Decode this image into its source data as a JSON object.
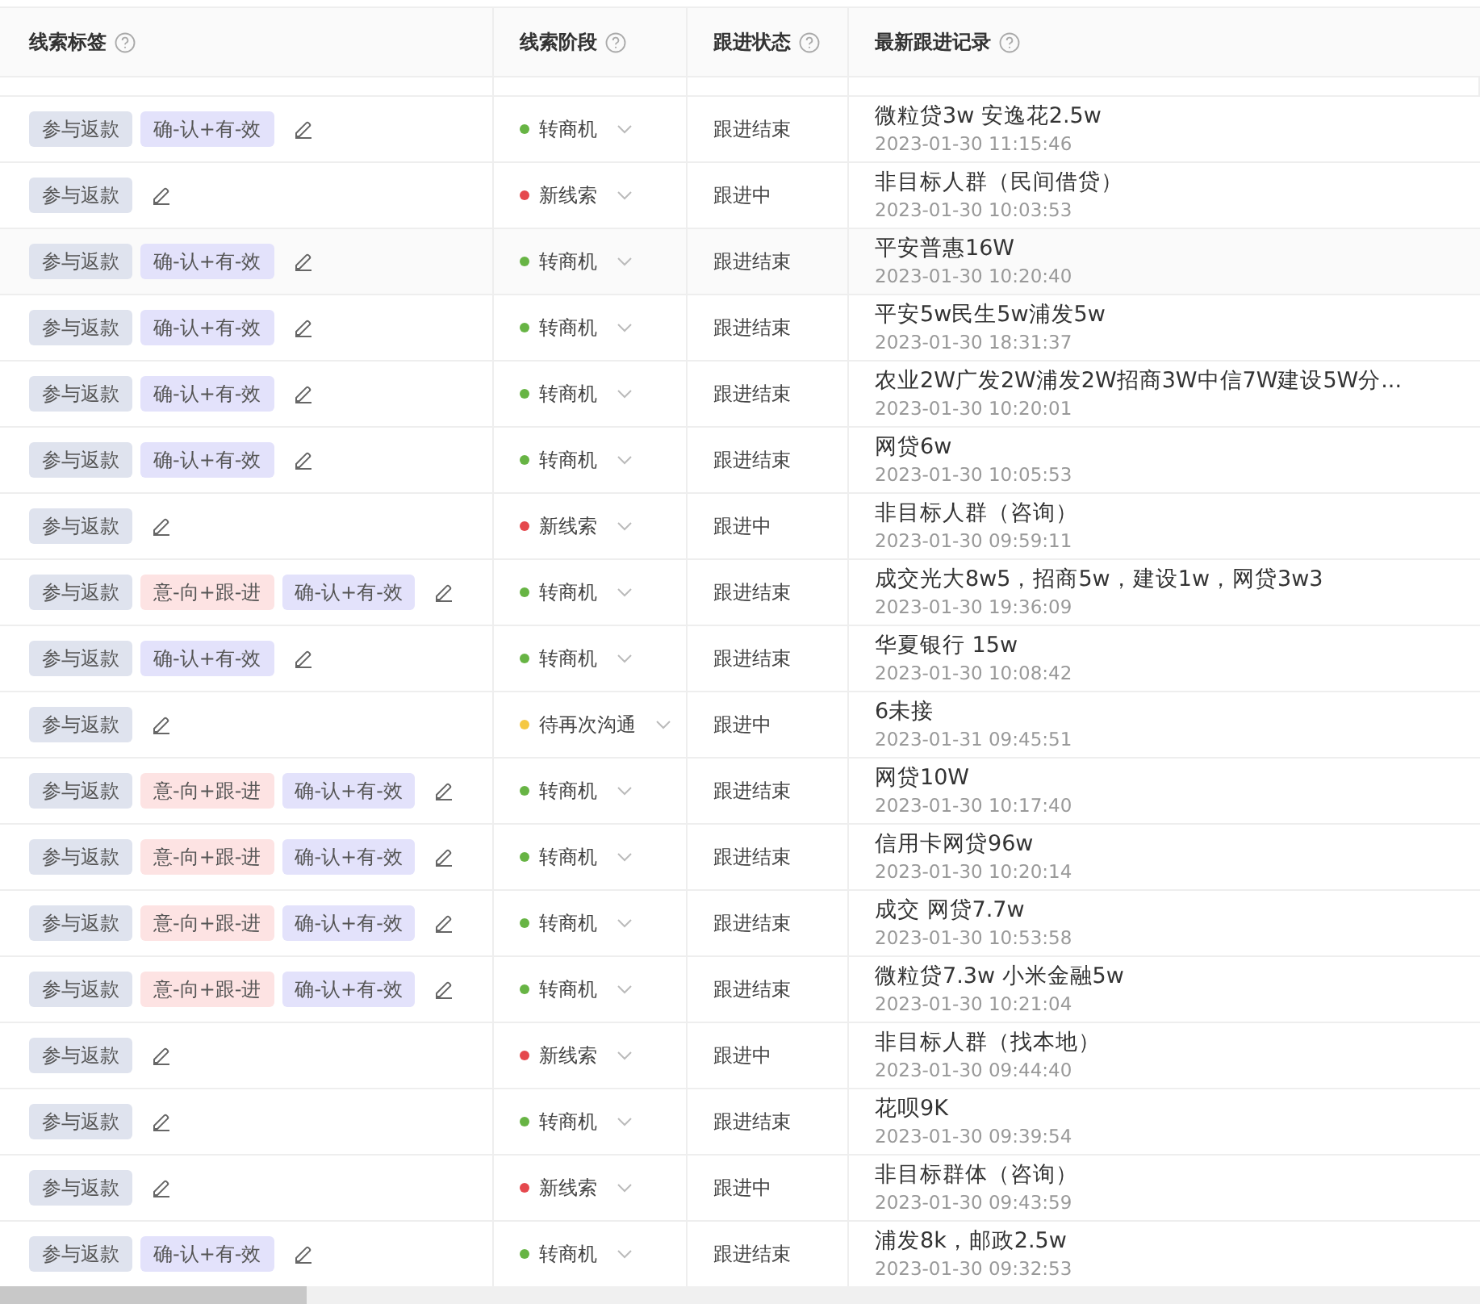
{
  "table": {
    "columns": [
      {
        "label": "线索标签"
      },
      {
        "label": "线索阶段"
      },
      {
        "label": "跟进状态"
      },
      {
        "label": "最新跟进记录"
      }
    ],
    "rows": [
      {
        "tags": [
          {
            "kind": "refund",
            "text": "参与返款"
          },
          {
            "kind": "confirm",
            "text": "确-认+有-效"
          }
        ],
        "stage": {
          "text": "转商机",
          "color": "#67b444"
        },
        "status": "跟进结束",
        "record": "微粒贷3w 安逸花2.5w",
        "time": "2023-01-30 11:15:46"
      },
      {
        "tags": [
          {
            "kind": "refund",
            "text": "参与返款"
          }
        ],
        "stage": {
          "text": "新线索",
          "color": "#e5484d"
        },
        "status": "跟进中",
        "record": "非目标人群（民间借贷）",
        "time": "2023-01-30 10:03:53"
      },
      {
        "tags": [
          {
            "kind": "refund",
            "text": "参与返款"
          },
          {
            "kind": "confirm",
            "text": "确-认+有-效"
          }
        ],
        "stage": {
          "text": "转商机",
          "color": "#67b444"
        },
        "status": "跟进结束",
        "record": "平安普惠16W",
        "time": "2023-01-30 10:20:40"
      },
      {
        "tags": [
          {
            "kind": "refund",
            "text": "参与返款"
          },
          {
            "kind": "confirm",
            "text": "确-认+有-效"
          }
        ],
        "stage": {
          "text": "转商机",
          "color": "#67b444"
        },
        "status": "跟进结束",
        "record": "平安5w民生5w浦发5w",
        "time": "2023-01-30 18:31:37"
      },
      {
        "tags": [
          {
            "kind": "refund",
            "text": "参与返款"
          },
          {
            "kind": "confirm",
            "text": "确-认+有-效"
          }
        ],
        "stage": {
          "text": "转商机",
          "color": "#67b444"
        },
        "status": "跟进结束",
        "record": "农业2W广发2W浦发2W招商3W中信7W建设5W分...",
        "time": "2023-01-30 10:20:01"
      },
      {
        "tags": [
          {
            "kind": "refund",
            "text": "参与返款"
          },
          {
            "kind": "confirm",
            "text": "确-认+有-效"
          }
        ],
        "stage": {
          "text": "转商机",
          "color": "#67b444"
        },
        "status": "跟进结束",
        "record": "网贷6w",
        "time": "2023-01-30 10:05:53"
      },
      {
        "tags": [
          {
            "kind": "refund",
            "text": "参与返款"
          }
        ],
        "stage": {
          "text": "新线索",
          "color": "#e5484d"
        },
        "status": "跟进中",
        "record": "非目标人群（咨询）",
        "time": "2023-01-30 09:59:11"
      },
      {
        "tags": [
          {
            "kind": "refund",
            "text": "参与返款"
          },
          {
            "kind": "intent",
            "text": "意-向+跟-进"
          },
          {
            "kind": "confirm",
            "text": "确-认+有-效"
          }
        ],
        "stage": {
          "text": "转商机",
          "color": "#67b444"
        },
        "status": "跟进结束",
        "record": "成交光大8w5，招商5w，建设1w，网贷3w3",
        "time": "2023-01-30 19:36:09"
      },
      {
        "tags": [
          {
            "kind": "refund",
            "text": "参与返款"
          },
          {
            "kind": "confirm",
            "text": "确-认+有-效"
          }
        ],
        "stage": {
          "text": "转商机",
          "color": "#67b444"
        },
        "status": "跟进结束",
        "record": "华夏银行 15w",
        "time": "2023-01-30 10:08:42"
      },
      {
        "tags": [
          {
            "kind": "refund",
            "text": "参与返款"
          }
        ],
        "stage": {
          "text": "待再次沟通",
          "color": "#f5c842"
        },
        "status": "跟进中",
        "record": "6未接",
        "time": "2023-01-31 09:45:51"
      },
      {
        "tags": [
          {
            "kind": "refund",
            "text": "参与返款"
          },
          {
            "kind": "intent",
            "text": "意-向+跟-进"
          },
          {
            "kind": "confirm",
            "text": "确-认+有-效"
          }
        ],
        "stage": {
          "text": "转商机",
          "color": "#67b444"
        },
        "status": "跟进结束",
        "record": "网贷10W",
        "time": "2023-01-30 10:17:40"
      },
      {
        "tags": [
          {
            "kind": "refund",
            "text": "参与返款"
          },
          {
            "kind": "intent",
            "text": "意-向+跟-进"
          },
          {
            "kind": "confirm",
            "text": "确-认+有-效"
          }
        ],
        "stage": {
          "text": "转商机",
          "color": "#67b444"
        },
        "status": "跟进结束",
        "record": "信用卡网贷96w",
        "time": "2023-01-30 10:20:14"
      },
      {
        "tags": [
          {
            "kind": "refund",
            "text": "参与返款"
          },
          {
            "kind": "intent",
            "text": "意-向+跟-进"
          },
          {
            "kind": "confirm",
            "text": "确-认+有-效"
          }
        ],
        "stage": {
          "text": "转商机",
          "color": "#67b444"
        },
        "status": "跟进结束",
        "record": "成交 网贷7.7w",
        "time": "2023-01-30 10:53:58"
      },
      {
        "tags": [
          {
            "kind": "refund",
            "text": "参与返款"
          },
          {
            "kind": "intent",
            "text": "意-向+跟-进"
          },
          {
            "kind": "confirm",
            "text": "确-认+有-效"
          }
        ],
        "stage": {
          "text": "转商机",
          "color": "#67b444"
        },
        "status": "跟进结束",
        "record": "微粒贷7.3w 小米金融5w",
        "time": "2023-01-30 10:21:04"
      },
      {
        "tags": [
          {
            "kind": "refund",
            "text": "参与返款"
          }
        ],
        "stage": {
          "text": "新线索",
          "color": "#e5484d"
        },
        "status": "跟进中",
        "record": "非目标人群（找本地）",
        "time": "2023-01-30 09:44:40"
      },
      {
        "tags": [
          {
            "kind": "refund",
            "text": "参与返款"
          }
        ],
        "stage": {
          "text": "转商机",
          "color": "#67b444"
        },
        "status": "跟进结束",
        "record": "花呗9K",
        "time": "2023-01-30 09:39:54"
      },
      {
        "tags": [
          {
            "kind": "refund",
            "text": "参与返款"
          }
        ],
        "stage": {
          "text": "新线索",
          "color": "#e5484d"
        },
        "status": "跟进中",
        "record": "非目标群体（咨询）",
        "time": "2023-01-30 09:43:59"
      },
      {
        "tags": [
          {
            "kind": "refund",
            "text": "参与返款"
          },
          {
            "kind": "confirm",
            "text": "确-认+有-效"
          }
        ],
        "stage": {
          "text": "转商机",
          "color": "#67b444"
        },
        "status": "跟进结束",
        "record": "浦发8k，邮政2.5w",
        "time": "2023-01-30 09:32:53"
      }
    ]
  }
}
